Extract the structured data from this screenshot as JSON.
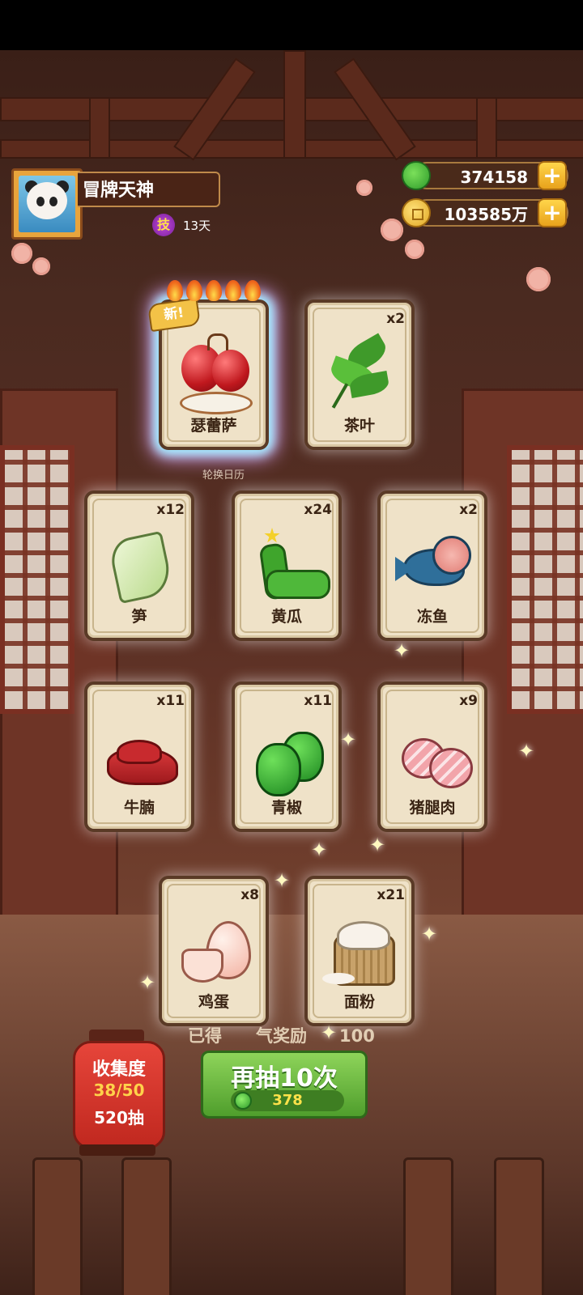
{
  "player": {
    "name": "冒牌天神",
    "skill_badge": "技",
    "skill_days": "13天"
  },
  "currency": {
    "jade": "374158",
    "coins": "103585万",
    "plus": "+"
  },
  "calendar_label": "轮换日历",
  "cards": [
    {
      "name": "瑟蕾萨",
      "count": "",
      "new": true,
      "new_label": "新!",
      "flames": 5,
      "icon": "cherry-dish-icon"
    },
    {
      "name": "茶叶",
      "count": "x2",
      "icon": "tea-leaf-icon"
    },
    {
      "name": "笋",
      "count": "x12",
      "icon": "bamboo-shoot-icon"
    },
    {
      "name": "黄瓜",
      "count": "x24",
      "icon": "cucumber-icon"
    },
    {
      "name": "冻鱼",
      "count": "x2",
      "icon": "frozen-fish-icon"
    },
    {
      "name": "牛腩",
      "count": "x11",
      "icon": "beef-brisket-icon"
    },
    {
      "name": "青椒",
      "count": "x11",
      "icon": "green-pepper-icon"
    },
    {
      "name": "猪腿肉",
      "count": "x9",
      "icon": "pork-leg-icon"
    },
    {
      "name": "鸡蛋",
      "count": "x8",
      "icon": "egg-icon"
    },
    {
      "name": "面粉",
      "count": "x21",
      "icon": "flour-sack-icon"
    }
  ],
  "reward": {
    "prefix": "已得",
    "mid": "气奖励",
    "value": "100"
  },
  "collection": {
    "title": "收集度",
    "progress": "38/50",
    "draws": "520抽"
  },
  "draw_button": {
    "label": "再抽10次",
    "cost": "378"
  }
}
